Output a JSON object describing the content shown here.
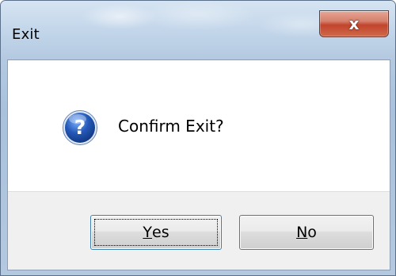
{
  "window": {
    "title": "Exit",
    "close_glyph": "x"
  },
  "dialog": {
    "icon": "question-icon",
    "message": "Confirm Exit?"
  },
  "buttons": {
    "yes": {
      "mnemonic": "Y",
      "rest": "es"
    },
    "no": {
      "mnemonic": "N",
      "rest": "o"
    }
  },
  "colors": {
    "close_button": "#c2442c",
    "question_icon": "#2458b8",
    "focus_border": "#3c7fb1"
  }
}
